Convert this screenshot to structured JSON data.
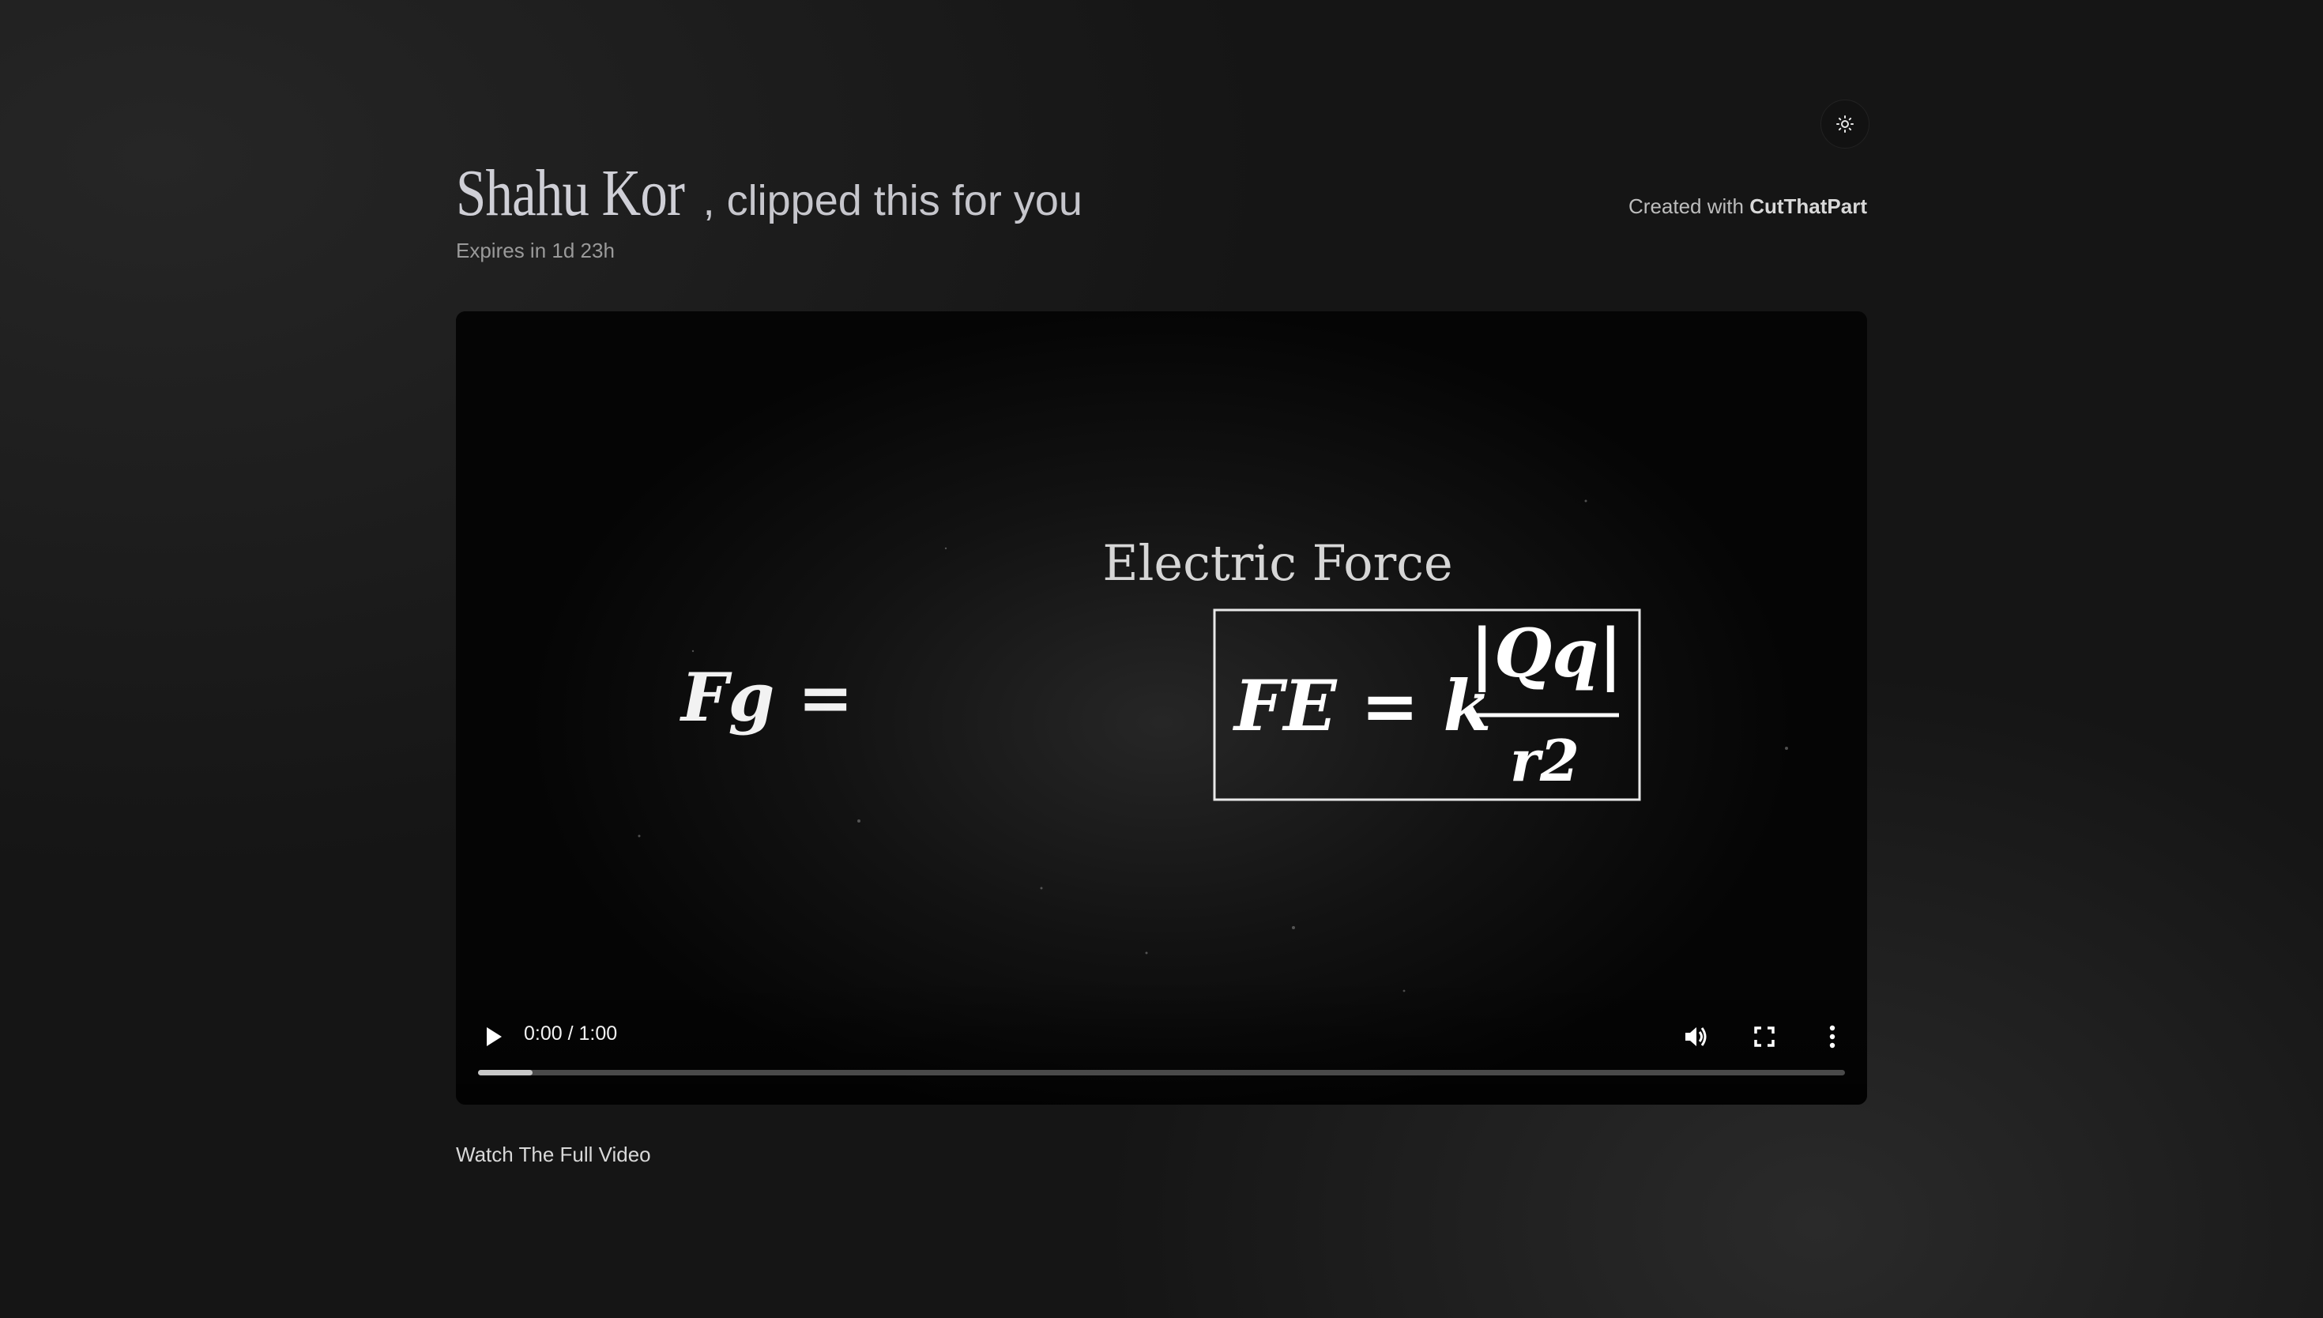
{
  "header": {
    "name": "Shahu Kor",
    "clipped_text": ", clipped this for you",
    "expires": "Expires in 1d 23h",
    "created_prefix": "Created with",
    "created_brand": "CutThatPart"
  },
  "theme_toggle": {
    "icon": "sun-icon"
  },
  "video": {
    "frame": {
      "left_equation": "Fg =",
      "title": "Electric Force",
      "formula_lhs": "FE = k",
      "numerator": "|Qq|",
      "denominator": "r2"
    },
    "controls": {
      "time": "0:00 / 1:00",
      "progress": 0.04,
      "play_icon": "play-icon",
      "volume_icon": "volume-icon",
      "fullscreen_icon": "fullscreen-icon",
      "more_icon": "more-vertical-icon"
    }
  },
  "footer": {
    "watch_link": "Watch The Full Video"
  }
}
